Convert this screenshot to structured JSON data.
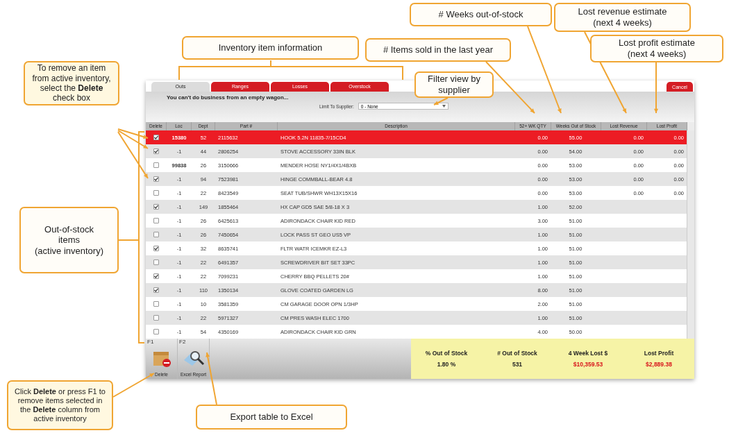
{
  "callouts": [
    {
      "text": "# Weeks out-of-stock"
    },
    {
      "text": "Lost revenue estimate\n(next 4 weeks)"
    },
    {
      "text": "Inventory  item information"
    },
    {
      "text": "# Items sold in the last year"
    },
    {
      "text": "Lost profit estimate\n(next 4 weeks)"
    },
    {
      "text": "To remove an item from active inventory, select the **Delete** check box"
    },
    {
      "text": "Filter view by\nsupplier"
    },
    {
      "text": "Out-of-stock\nitems\n(active inventory)"
    },
    {
      "text": "Click **Delete** or press F1 to remove items selected in the **Delete** column from active inventory"
    },
    {
      "text": "Export table to Excel"
    }
  ],
  "window": {
    "tabs": [
      {
        "label": "Outs",
        "selected": true
      },
      {
        "label": "Ranges",
        "selected": false
      },
      {
        "label": "Losses",
        "selected": false
      },
      {
        "label": "Overstock",
        "selected": false
      }
    ],
    "cancel": "Cancel",
    "message": "You can't do business from an empty wagon...",
    "filter": {
      "label": "Limit To Supplier:",
      "value": "0 - None"
    },
    "columns": [
      "Delete",
      "Loc",
      "Dept",
      "Part #",
      "Description",
      "52+ WK QTY",
      "Weeks Out of Stock",
      "Lost Revenue",
      "Lost Profit"
    ],
    "rows": [
      {
        "selected": true,
        "delete": true,
        "loc": "15380",
        "dept": "52",
        "part": "2115632",
        "description": "HOOK 5.2N 11835-7/15CD4",
        "qty": "0.00",
        "weeks": "55.00",
        "revenue": "0.00",
        "profit": "0.00"
      },
      {
        "selected": false,
        "delete": true,
        "loc": "-1",
        "dept": "44",
        "part": "2806254",
        "description": "STOVE ACCESSORY 33IN BLK",
        "qty": "0.00",
        "weeks": "54.00",
        "revenue": "0.00",
        "profit": "0.00"
      },
      {
        "selected": false,
        "delete": false,
        "loc": "99838",
        "dept": "26",
        "part": "3150666",
        "description": "MENDER HOSE NY1/4X1/4BXB",
        "qty": "0.00",
        "weeks": "53.00",
        "revenue": "0.00",
        "profit": "0.00"
      },
      {
        "selected": false,
        "delete": true,
        "loc": "-1",
        "dept": "94",
        "part": "7523981",
        "description": "HINGE COMMBALL-BEAR 4.8",
        "qty": "0.00",
        "weeks": "53.00",
        "revenue": "0.00",
        "profit": "0.00"
      },
      {
        "selected": false,
        "delete": false,
        "loc": "-1",
        "dept": "22",
        "part": "8423549",
        "description": "SEAT TUB/SHWR WH13X15X16",
        "qty": "0.00",
        "weeks": "53.00",
        "revenue": "0.00",
        "profit": "0.00"
      },
      {
        "selected": false,
        "delete": true,
        "loc": "-1",
        "dept": "149",
        "part": "1855464",
        "description": "HX CAP GD5 SAE 5/8-18 X 3",
        "qty": "1.00",
        "weeks": "52.00"
      },
      {
        "selected": false,
        "delete": false,
        "loc": "-1",
        "dept": "26",
        "part": "6425613",
        "description": "ADIRONDACK CHAIR KID RED",
        "qty": "3.00",
        "weeks": "51.00"
      },
      {
        "selected": false,
        "delete": false,
        "loc": "-1",
        "dept": "26",
        "part": "7450654",
        "description": "LOCK PASS ST GEO US5 VP",
        "qty": "1.00",
        "weeks": "51.00"
      },
      {
        "selected": false,
        "delete": true,
        "loc": "-1",
        "dept": "32",
        "part": "8635741",
        "description": "FLTR WATR ICEMKR EZ-L3",
        "qty": "1.00",
        "weeks": "51.00"
      },
      {
        "selected": false,
        "delete": false,
        "loc": "-1",
        "dept": "22",
        "part": "6491357",
        "description": "SCREWDRIVER BIT SET 33PC",
        "qty": "1.00",
        "weeks": "51.00"
      },
      {
        "selected": false,
        "delete": true,
        "loc": "-1",
        "dept": "22",
        "part": "7099231",
        "description": "CHERRY BBQ PELLETS 20#",
        "qty": "1.00",
        "weeks": "51.00"
      },
      {
        "selected": false,
        "delete": true,
        "loc": "-1",
        "dept": "110",
        "part": "1350134",
        "description": "GLOVE COATED GARDEN LG",
        "qty": "8.00",
        "weeks": "51.00"
      },
      {
        "selected": false,
        "delete": false,
        "loc": "-1",
        "dept": "10",
        "part": "3581359",
        "description": "CM GARAGE DOOR OPN 1/3HP",
        "qty": "2.00",
        "weeks": "51.00"
      },
      {
        "selected": false,
        "delete": false,
        "loc": "-1",
        "dept": "22",
        "part": "5971327",
        "description": "CM PRES WASH ELEC 1700",
        "qty": "1.00",
        "weeks": "51.00"
      },
      {
        "selected": false,
        "delete": false,
        "loc": "-1",
        "dept": "54",
        "part": "4350169",
        "description": "ADIRONDACK CHAIR KID GRN",
        "qty": "4.00",
        "weeks": "50.00"
      }
    ],
    "tools": [
      {
        "key": "F1",
        "label": "Delete",
        "kind": "delete"
      },
      {
        "key": "F2",
        "label": "Excel Report",
        "kind": "excel"
      }
    ],
    "stats": [
      {
        "label": "% Out of Stock",
        "value": "1.80 %",
        "color": "#222222"
      },
      {
        "label": "# Out of Stock",
        "value": "531",
        "color": "#222222"
      },
      {
        "label": "4 Week Lost $",
        "value": "$10,359.53",
        "color": "#d8141b"
      },
      {
        "label": "Lost Profit",
        "value": "$2,889.38",
        "color": "#d8141b"
      }
    ]
  }
}
